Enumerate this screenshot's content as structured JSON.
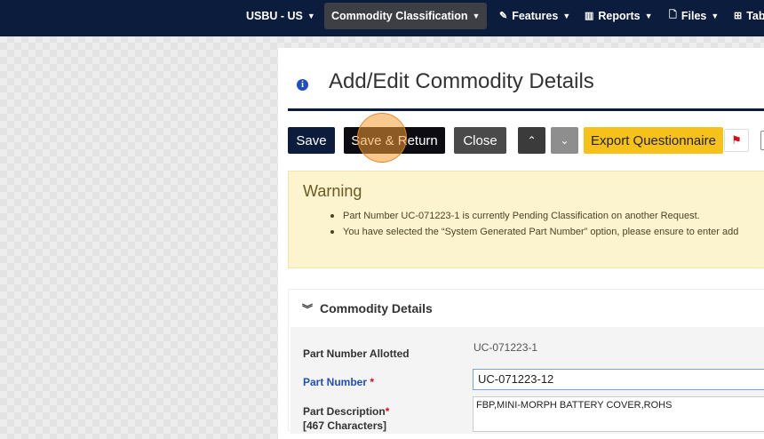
{
  "navbar": {
    "items": [
      {
        "label": "USBU - US",
        "icon": "caret-down-icon"
      },
      {
        "label": "Commodity Classification",
        "icon": "caret-down-icon",
        "active": true
      },
      {
        "label": "Features",
        "icon": "pencil-icon"
      },
      {
        "label": "Reports",
        "icon": "bar-chart-icon"
      },
      {
        "label": "Files",
        "icon": "file-icon"
      },
      {
        "label": "Tab",
        "icon": "table-icon"
      }
    ]
  },
  "page": {
    "title": "Add/Edit Commodity Details",
    "title_icon": "info-icon"
  },
  "toolbar": {
    "save": "Save",
    "save_return": "Save & Return",
    "close": "Close",
    "up": "⌃",
    "down": "⌄",
    "export": "Export Questionnaire",
    "flag": "⚑"
  },
  "warning": {
    "title": "Warning",
    "items": [
      "Part Number UC-071223-1 is currently Pending Classification on another Request.",
      "You have selected the “System Generated Part Number” option, please ensure to enter add"
    ]
  },
  "commodity": {
    "section_title": "Commodity Details",
    "part_number_allotted_label": "Part Number Allotted",
    "part_number_allotted_value": "UC-071223-1",
    "part_number_label": "Part Number",
    "part_number_value": "UC-071223-12",
    "part_description_label": "Part Description",
    "part_description_chars": "[467 Characters]",
    "part_description_value": "FBP,MINI-MORPH BATTERY COVER,ROHS",
    "required_mark": "*"
  },
  "colors": {
    "navbar": "#0c1c3c",
    "export_button": "#f6c21a",
    "warning_bg": "#fcf4cf",
    "link_blue": "#1f4fb8"
  }
}
